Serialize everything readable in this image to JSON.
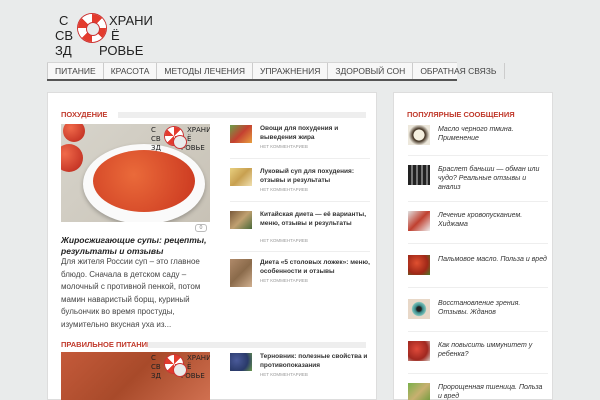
{
  "logo": {
    "line1_left": "С",
    "line1_right": "ХРАНИ",
    "line2_left": "СВ",
    "line2_right": "Ё",
    "line3_left": "ЗД",
    "line3_right": "РОВЬЕ"
  },
  "nav": {
    "items": [
      "ПИТАНИЕ",
      "КРАСОТА",
      "МЕТОДЫ ЛЕЧЕНИЯ",
      "УПРАЖНЕНИЯ",
      "ЗДОРОВЫЙ СОН",
      "ОБРАТНАЯ СВЯЗЬ"
    ]
  },
  "sections": {
    "weight_loss": {
      "title": "ПОХУДЕНИЕ",
      "feature": {
        "title": "Жиросжигающие супы: рецепты, результаты и отзывы",
        "excerpt": "Для жителя России суп – это главное блюдо. Сначала в детском саду – молочный с противной пенкой, потом мамин наваристый борщ, куриный бульончик во время простуды, изумительно вкусная уха из...",
        "comments": "0"
      },
      "items": [
        {
          "title": "Овощи для похудения и выведения жира",
          "meta": "НЕТ КОММЕНТАРИЕВ"
        },
        {
          "title": "Луковый суп для похудения: отзывы и результаты",
          "meta": "НЕТ КОММЕНТАРИЕВ"
        },
        {
          "title": "Китайская диета — её варианты, меню, отзывы и результаты",
          "meta": "НЕТ КОММЕНТАРИЕВ"
        },
        {
          "title": "Диета «5 столовых ложек»: меню, особенности и отзывы",
          "meta": "НЕТ КОММЕНТАРИЕВ"
        }
      ]
    },
    "proper_nutrition": {
      "title": "ПРАВИЛЬНОЕ ПИТАНИЕ",
      "items": [
        {
          "title": "Терновник: полезные свойства и противопоказания",
          "meta": "НЕТ КОММЕНТАРИЕВ"
        }
      ]
    }
  },
  "sidebar": {
    "title": "ПОПУЛЯРНЫЕ СООБЩЕНИЯ",
    "items": [
      {
        "title": "Масло черного тмина. Применение"
      },
      {
        "title": "Браслет баньши — обман или чудо? Реальные отзывы и анализ"
      },
      {
        "title": "Лечение кровопусканием. Хиджама"
      },
      {
        "title": "Пальмовое масло. Польза и вред"
      },
      {
        "title": "Восстановление зрения. Отзывы. Жданов"
      },
      {
        "title": "Как повысить иммунитет у ребенка?"
      },
      {
        "title": "Пророщенная пшеница. Польза и вред"
      }
    ]
  },
  "colors": {
    "accent": "#c0392b",
    "background": "#e9ebeb"
  }
}
